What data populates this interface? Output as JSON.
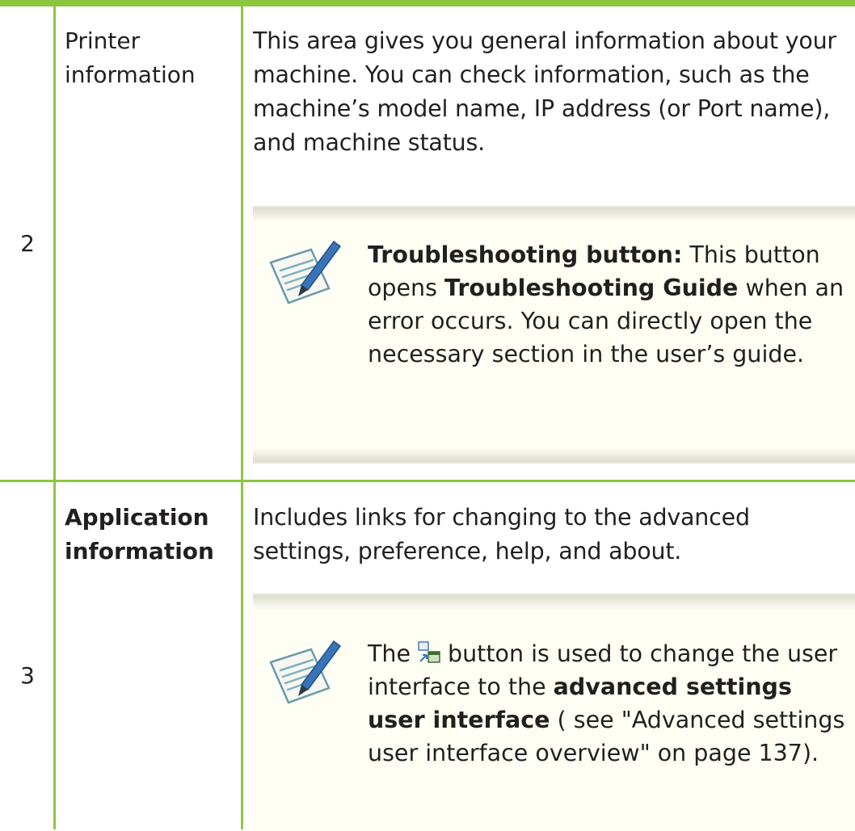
{
  "rows": [
    {
      "number": "2",
      "label": "Printer information",
      "description": "This area gives you general information about your machine. You can check information, such as the machine’s model name, IP address (or Port name), and machine status.",
      "note": {
        "icon": "note-pen-icon",
        "lead": "Troubleshooting button:",
        "text_1": " This button opens ",
        "emph": "Troubleshooting Guide",
        "text_2": " when an error occurs. You can directly open the necessary section in the user’s guide."
      }
    },
    {
      "number": "3",
      "label": "Application information",
      "description": "Includes links for changing to the advanced settings, preference, help, and about.",
      "note": {
        "icon": "note-pen-icon",
        "text_1": "The",
        "button_icon": "advanced-settings-switch-icon",
        "text_2": "button is used to change the user interface to the ",
        "emph": "advanced settings user interface",
        "text_3": " ( see \"Advanced settings user interface overview\" on page 137)."
      }
    }
  ],
  "colors": {
    "rule": "#8cc63f",
    "note_bg": "#fffef5",
    "text": "#231f20"
  }
}
